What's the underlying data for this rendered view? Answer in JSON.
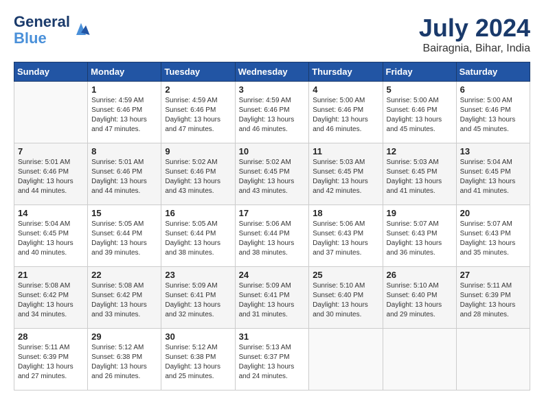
{
  "header": {
    "logo_line1": "General",
    "logo_line2": "Blue",
    "month": "July 2024",
    "location": "Bairagnia, Bihar, India"
  },
  "weekdays": [
    "Sunday",
    "Monday",
    "Tuesday",
    "Wednesday",
    "Thursday",
    "Friday",
    "Saturday"
  ],
  "weeks": [
    [
      {
        "day": "",
        "info": ""
      },
      {
        "day": "1",
        "info": "Sunrise: 4:59 AM\nSunset: 6:46 PM\nDaylight: 13 hours\nand 47 minutes."
      },
      {
        "day": "2",
        "info": "Sunrise: 4:59 AM\nSunset: 6:46 PM\nDaylight: 13 hours\nand 47 minutes."
      },
      {
        "day": "3",
        "info": "Sunrise: 4:59 AM\nSunset: 6:46 PM\nDaylight: 13 hours\nand 46 minutes."
      },
      {
        "day": "4",
        "info": "Sunrise: 5:00 AM\nSunset: 6:46 PM\nDaylight: 13 hours\nand 46 minutes."
      },
      {
        "day": "5",
        "info": "Sunrise: 5:00 AM\nSunset: 6:46 PM\nDaylight: 13 hours\nand 45 minutes."
      },
      {
        "day": "6",
        "info": "Sunrise: 5:00 AM\nSunset: 6:46 PM\nDaylight: 13 hours\nand 45 minutes."
      }
    ],
    [
      {
        "day": "7",
        "info": "Sunrise: 5:01 AM\nSunset: 6:46 PM\nDaylight: 13 hours\nand 44 minutes."
      },
      {
        "day": "8",
        "info": "Sunrise: 5:01 AM\nSunset: 6:46 PM\nDaylight: 13 hours\nand 44 minutes."
      },
      {
        "day": "9",
        "info": "Sunrise: 5:02 AM\nSunset: 6:46 PM\nDaylight: 13 hours\nand 43 minutes."
      },
      {
        "day": "10",
        "info": "Sunrise: 5:02 AM\nSunset: 6:45 PM\nDaylight: 13 hours\nand 43 minutes."
      },
      {
        "day": "11",
        "info": "Sunrise: 5:03 AM\nSunset: 6:45 PM\nDaylight: 13 hours\nand 42 minutes."
      },
      {
        "day": "12",
        "info": "Sunrise: 5:03 AM\nSunset: 6:45 PM\nDaylight: 13 hours\nand 41 minutes."
      },
      {
        "day": "13",
        "info": "Sunrise: 5:04 AM\nSunset: 6:45 PM\nDaylight: 13 hours\nand 41 minutes."
      }
    ],
    [
      {
        "day": "14",
        "info": "Sunrise: 5:04 AM\nSunset: 6:45 PM\nDaylight: 13 hours\nand 40 minutes."
      },
      {
        "day": "15",
        "info": "Sunrise: 5:05 AM\nSunset: 6:44 PM\nDaylight: 13 hours\nand 39 minutes."
      },
      {
        "day": "16",
        "info": "Sunrise: 5:05 AM\nSunset: 6:44 PM\nDaylight: 13 hours\nand 38 minutes."
      },
      {
        "day": "17",
        "info": "Sunrise: 5:06 AM\nSunset: 6:44 PM\nDaylight: 13 hours\nand 38 minutes."
      },
      {
        "day": "18",
        "info": "Sunrise: 5:06 AM\nSunset: 6:43 PM\nDaylight: 13 hours\nand 37 minutes."
      },
      {
        "day": "19",
        "info": "Sunrise: 5:07 AM\nSunset: 6:43 PM\nDaylight: 13 hours\nand 36 minutes."
      },
      {
        "day": "20",
        "info": "Sunrise: 5:07 AM\nSunset: 6:43 PM\nDaylight: 13 hours\nand 35 minutes."
      }
    ],
    [
      {
        "day": "21",
        "info": "Sunrise: 5:08 AM\nSunset: 6:42 PM\nDaylight: 13 hours\nand 34 minutes."
      },
      {
        "day": "22",
        "info": "Sunrise: 5:08 AM\nSunset: 6:42 PM\nDaylight: 13 hours\nand 33 minutes."
      },
      {
        "day": "23",
        "info": "Sunrise: 5:09 AM\nSunset: 6:41 PM\nDaylight: 13 hours\nand 32 minutes."
      },
      {
        "day": "24",
        "info": "Sunrise: 5:09 AM\nSunset: 6:41 PM\nDaylight: 13 hours\nand 31 minutes."
      },
      {
        "day": "25",
        "info": "Sunrise: 5:10 AM\nSunset: 6:40 PM\nDaylight: 13 hours\nand 30 minutes."
      },
      {
        "day": "26",
        "info": "Sunrise: 5:10 AM\nSunset: 6:40 PM\nDaylight: 13 hours\nand 29 minutes."
      },
      {
        "day": "27",
        "info": "Sunrise: 5:11 AM\nSunset: 6:39 PM\nDaylight: 13 hours\nand 28 minutes."
      }
    ],
    [
      {
        "day": "28",
        "info": "Sunrise: 5:11 AM\nSunset: 6:39 PM\nDaylight: 13 hours\nand 27 minutes."
      },
      {
        "day": "29",
        "info": "Sunrise: 5:12 AM\nSunset: 6:38 PM\nDaylight: 13 hours\nand 26 minutes."
      },
      {
        "day": "30",
        "info": "Sunrise: 5:12 AM\nSunset: 6:38 PM\nDaylight: 13 hours\nand 25 minutes."
      },
      {
        "day": "31",
        "info": "Sunrise: 5:13 AM\nSunset: 6:37 PM\nDaylight: 13 hours\nand 24 minutes."
      },
      {
        "day": "",
        "info": ""
      },
      {
        "day": "",
        "info": ""
      },
      {
        "day": "",
        "info": ""
      }
    ]
  ]
}
